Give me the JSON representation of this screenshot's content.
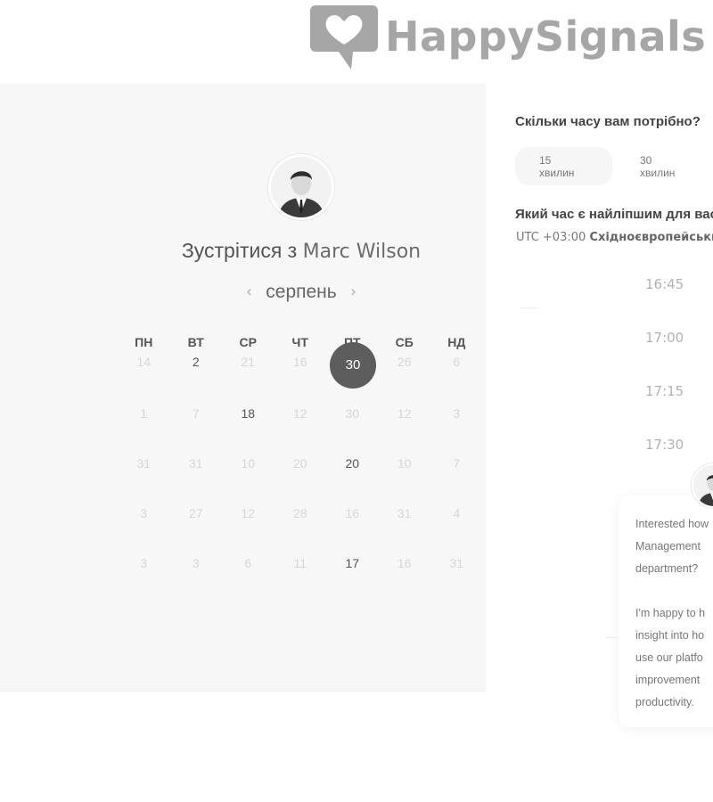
{
  "brand": {
    "name": "HappySignals",
    "color": "#a6a6a6"
  },
  "host": {
    "title_prefix": "Зустрітися з ",
    "name": "Marc Wilson",
    "avatar_icon": "user-avatar-icon"
  },
  "calendar": {
    "month": "серпень",
    "prev_icon": "chevron-left-icon",
    "next_icon": "chevron-right-icon",
    "weekdays": [
      "ПН",
      "ВТ",
      "СР",
      "ЧТ",
      "ПТ",
      "СБ",
      "НД"
    ],
    "weeks": [
      [
        "14",
        "2",
        "21",
        "16",
        "30",
        "26",
        "6"
      ],
      [
        "1",
        "7",
        "18",
        "12",
        "30",
        "12",
        "3"
      ],
      [
        "31",
        "31",
        "10",
        "20",
        "20",
        "10",
        "7"
      ],
      [
        "3",
        "27",
        "12",
        "28",
        "16",
        "31",
        "4"
      ],
      [
        "3",
        "3",
        "6",
        "11",
        "17",
        "16",
        "31"
      ]
    ],
    "available": [
      [
        0,
        1
      ],
      [
        1,
        2
      ],
      [
        2,
        4
      ],
      [
        4,
        4
      ]
    ],
    "selected": "30",
    "selected_color": "#5d5d5d"
  },
  "duration": {
    "question": "Скільки часу вам потрібно?",
    "options": [
      "15 хвилин",
      "30 хвилин"
    ],
    "active": "15 хвилин"
  },
  "time": {
    "question": "Який час є найліпшим для вас?",
    "tz_offset": "UTC +03:00",
    "tz_name": "Східноєвропейський час",
    "slots": [
      "16:45",
      "17:00",
      "17:15",
      "17:30"
    ]
  },
  "chat": {
    "avatar_icon": "user-avatar-icon",
    "p1": "Interested how\nManagement\ndepartment?",
    "p2": "I'm happy to h\ninsight into ho\nuse our platfo\nimprovement\nproductivity."
  }
}
